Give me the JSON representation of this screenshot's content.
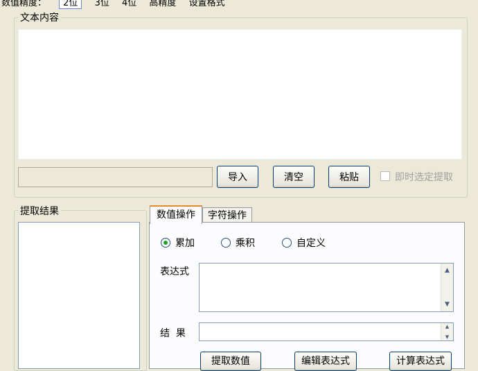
{
  "toolbar": {
    "precision_label": "数值精度：",
    "options": [
      "2位",
      "3位",
      "4位",
      "高精度",
      "设置格式"
    ],
    "selected": "2位"
  },
  "text_group": {
    "legend": "文本内容",
    "content": "",
    "path_value": "",
    "import_label": "导入",
    "clear_label": "清空",
    "paste_label": "粘贴",
    "instant_extract_label": "即时选定提取",
    "instant_extract_checked": false
  },
  "result_group": {
    "legend": "提取结果"
  },
  "tabs": {
    "items": [
      "数值操作",
      "字符操作"
    ],
    "active": "数值操作"
  },
  "numeric_ops": {
    "radios": [
      "累加",
      "乘积",
      "自定义"
    ],
    "selected": "累加",
    "expression_label": "表达式",
    "expression_value": "",
    "result_label": "结  果",
    "result_value": "",
    "buttons": [
      "提取数值",
      "编辑表达式",
      "计算表达式"
    ]
  },
  "icons": {
    "scroll_up": "arrow-up-icon",
    "scroll_down": "arrow-down-icon"
  }
}
